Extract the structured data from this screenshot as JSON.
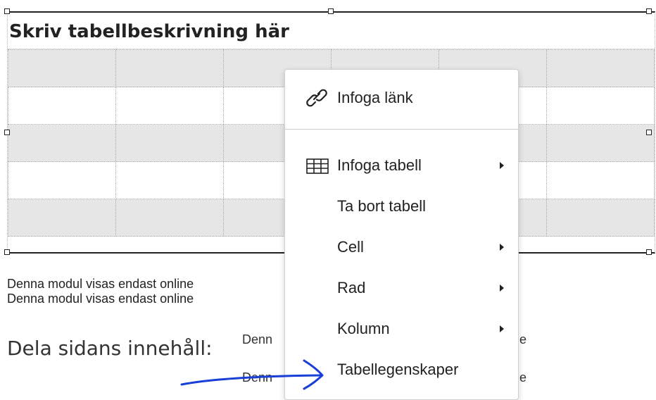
{
  "table": {
    "caption": "Skriv tabellbeskrivning här",
    "rows": 5,
    "cols": 6
  },
  "body_lines": [
    "Denna modul visas endast online",
    "Denna modul visas endast online"
  ],
  "share": {
    "label": "Dela sidans innehåll:",
    "links": [
      "Denn",
      "Denn"
    ],
    "trailing": [
      "e",
      "e"
    ]
  },
  "context_menu": {
    "items": [
      {
        "label": "Infoga länk",
        "icon": "link-icon",
        "submenu": false
      },
      {
        "label": "Infoga tabell",
        "icon": "table-icon",
        "submenu": true
      },
      {
        "label": "Ta bort tabell",
        "icon": null,
        "submenu": false
      },
      {
        "label": "Cell",
        "icon": null,
        "submenu": true
      },
      {
        "label": "Rad",
        "icon": null,
        "submenu": true
      },
      {
        "label": "Kolumn",
        "icon": null,
        "submenu": true
      },
      {
        "label": "Tabellegenskaper",
        "icon": null,
        "submenu": false
      }
    ]
  },
  "colors": {
    "shaded_row": "#e6e6e6",
    "annotation_arrow": "#1a3fd6"
  }
}
